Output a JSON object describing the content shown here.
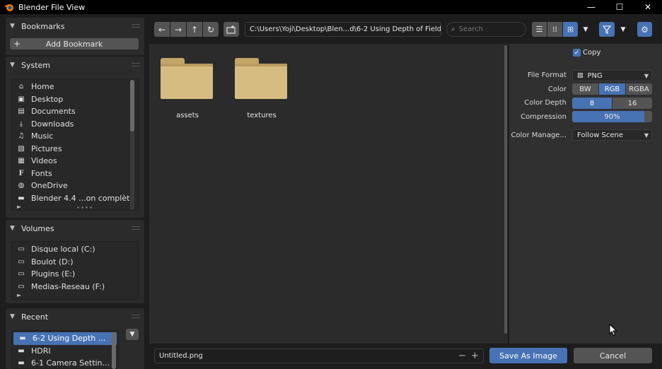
{
  "window": {
    "title": "Blender File View",
    "minimize": "—",
    "maximize": "☐",
    "close": "✕"
  },
  "sidebar": {
    "bookmarks": {
      "title": "Bookmarks",
      "add_label": "Add Bookmark"
    },
    "system": {
      "title": "System",
      "items": [
        {
          "label": "Home",
          "icon": "home-icon"
        },
        {
          "label": "Desktop",
          "icon": "desktop-icon"
        },
        {
          "label": "Documents",
          "icon": "documents-icon"
        },
        {
          "label": "Downloads",
          "icon": "downloads-icon"
        },
        {
          "label": "Music",
          "icon": "music-icon"
        },
        {
          "label": "Pictures",
          "icon": "pictures-icon"
        },
        {
          "label": "Videos",
          "icon": "videos-icon"
        },
        {
          "label": "Fonts",
          "icon": "fonts-icon"
        },
        {
          "label": "OneDrive",
          "icon": "globe-icon"
        },
        {
          "label": "Blender 4.4 ...on complète",
          "icon": "folder-icon"
        }
      ]
    },
    "volumes": {
      "title": "Volumes",
      "items": [
        {
          "label": "Disque local (C:)",
          "icon": "disk-icon"
        },
        {
          "label": "Boulot (D:)",
          "icon": "disk-icon"
        },
        {
          "label": "Plugins (E:)",
          "icon": "disk-icon"
        },
        {
          "label": "Medias-Reseau (F:)",
          "icon": "disk-icon"
        }
      ]
    },
    "recent": {
      "title": "Recent",
      "items": [
        {
          "label": "6-2 Using Depth ...",
          "icon": "folder-icon",
          "selected": true
        },
        {
          "label": "HDRI",
          "icon": "folder-icon",
          "selected": false
        },
        {
          "label": "6-1 Camera Settin...",
          "icon": "folder-icon",
          "selected": false
        }
      ]
    }
  },
  "toolbar": {
    "path": "C:\\Users\\Yoji\\Desktop\\Blen...d\\6-2 Using Depth of Field\\",
    "search_placeholder": "Search"
  },
  "files": [
    {
      "name": "assets",
      "type": "folder"
    },
    {
      "name": "textures",
      "type": "folder"
    }
  ],
  "settings": {
    "copy_label": "Copy",
    "copy_checked": true,
    "file_format_label": "File Format",
    "file_format_value": "PNG",
    "color_label": "Color",
    "color_options": [
      "BW",
      "RGB",
      "RGBA"
    ],
    "color_selected": "RGB",
    "color_depth_label": "Color Depth",
    "color_depth_options": [
      "8",
      "16"
    ],
    "color_depth_selected": "8",
    "compression_label": "Compression",
    "compression_value": "90%",
    "compression_fraction": 0.9,
    "color_manage_label": "Color Manage...",
    "color_manage_value": "Follow Scene"
  },
  "bottom": {
    "filename": "Untitled.png",
    "minus": "−",
    "plus": "+",
    "save_label": "Save As Image",
    "cancel_label": "Cancel"
  },
  "colors": {
    "accent": "#4772b3",
    "folder": "#d6bc80"
  }
}
